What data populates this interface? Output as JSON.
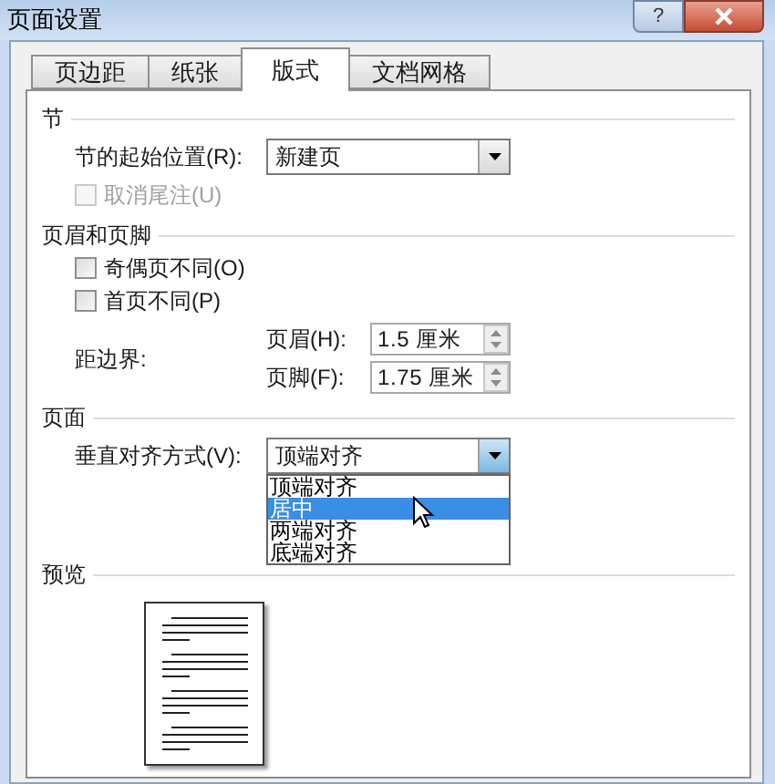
{
  "window": {
    "title": "页面设置",
    "help_button": "?"
  },
  "tabs": [
    {
      "label": "页边距",
      "selected": false
    },
    {
      "label": "纸张",
      "selected": false
    },
    {
      "label": "版式",
      "selected": true
    },
    {
      "label": "文档网格",
      "selected": false
    }
  ],
  "section": {
    "heading": "节",
    "start_label": "节的起始位置(R):",
    "start_value": "新建页",
    "suppress_endnotes": {
      "label": "取消尾注(U)",
      "checked": false,
      "disabled": true
    }
  },
  "headers_footers": {
    "heading": "页眉和页脚",
    "checkboxes": [
      {
        "label": "奇偶页不同(O)",
        "checked": false,
        "disabled": false
      },
      {
        "label": "首页不同(P)",
        "checked": false,
        "disabled": false
      }
    ],
    "from_edge_label": "距边界:",
    "fields": [
      {
        "label": "页眉(H):",
        "value": "1.5 厘米"
      },
      {
        "label": "页脚(F):",
        "value": "1.75 厘米"
      }
    ]
  },
  "page": {
    "heading": "页面",
    "vertical_alignment_label": "垂直对齐方式(V):",
    "vertical_alignment_value": "顶端对齐",
    "options": [
      {
        "label": "顶端对齐",
        "selected": false
      },
      {
        "label": "居中",
        "selected": true
      },
      {
        "label": "两端对齐",
        "selected": false
      },
      {
        "label": "底端对齐",
        "selected": false
      }
    ]
  },
  "preview": {
    "heading": "预览"
  }
}
